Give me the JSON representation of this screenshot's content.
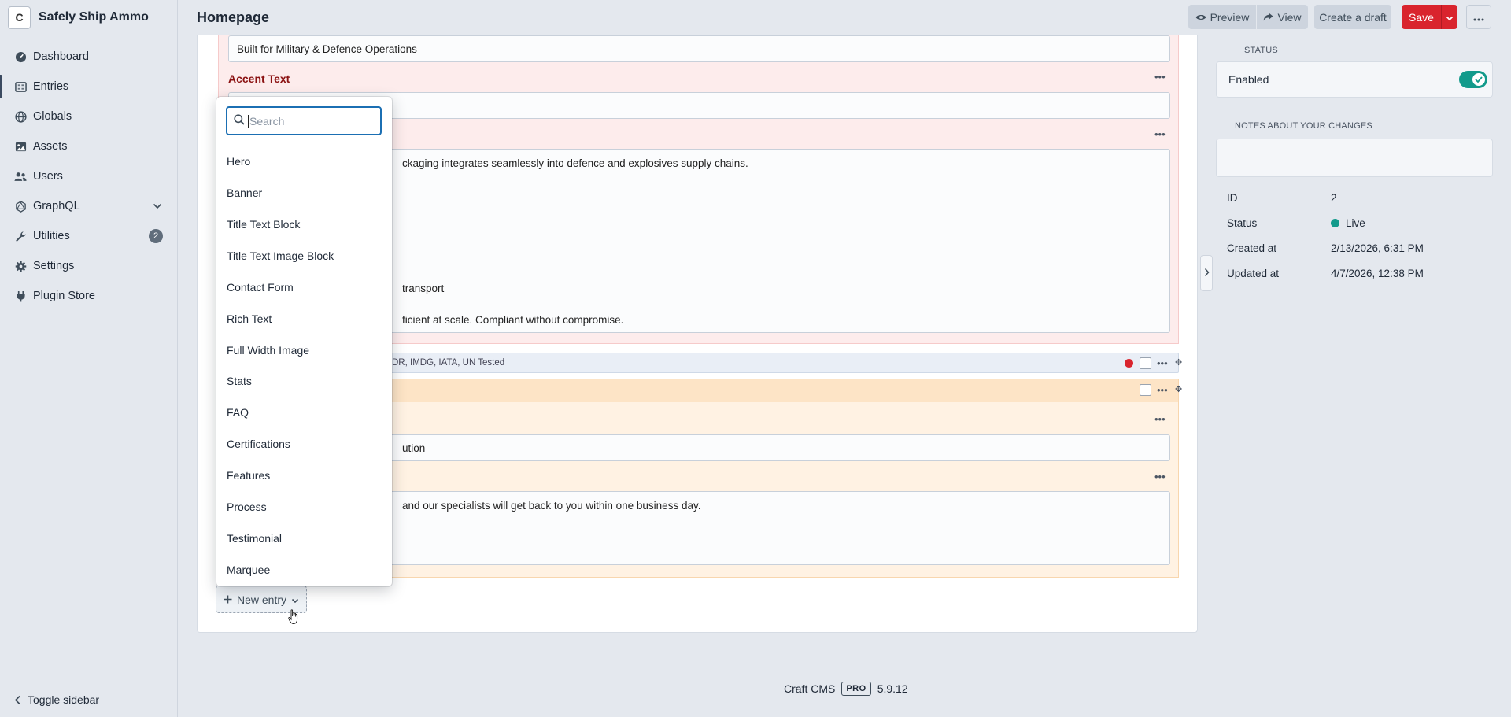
{
  "site": {
    "logo_letter": "C",
    "name": "Safely Ship Ammo"
  },
  "nav": {
    "items": [
      {
        "label": "Dashboard",
        "icon": "gauge-icon"
      },
      {
        "label": "Entries",
        "icon": "entries-icon"
      },
      {
        "label": "Globals",
        "icon": "globe-icon"
      },
      {
        "label": "Assets",
        "icon": "image-icon"
      },
      {
        "label": "Users",
        "icon": "users-icon"
      },
      {
        "label": "GraphQL",
        "icon": "graphql-icon"
      },
      {
        "label": "Utilities",
        "icon": "wrench-icon",
        "badge": "2"
      },
      {
        "label": "Settings",
        "icon": "gear-icon"
      },
      {
        "label": "Plugin Store",
        "icon": "plug-icon"
      }
    ],
    "toggle_sidebar": "Toggle sidebar"
  },
  "header": {
    "title": "Homepage",
    "preview": "Preview",
    "view": "View",
    "create_draft": "Create a draft",
    "save": "Save"
  },
  "editor": {
    "heading_value": "Built for Military & Defence Operations",
    "accent_text_label": "Accent Text",
    "body_lines": [
      "ckaging integrates seamlessly into defence and explosives supply chains.",
      "transport",
      "ficient at scale. Compliant without compromise."
    ],
    "collapsed_block_text": "DR, IMDG, IATA, UN Tested",
    "orange_input_value": "ution",
    "orange_textarea_text": "and our specialists will get back to you within one business day.",
    "new_entry_label": "New entry"
  },
  "dropdown": {
    "search_placeholder": "Search",
    "items": [
      "Hero",
      "Banner",
      "Title Text Block",
      "Title Text Image Block",
      "Contact Form",
      "Rich Text",
      "Full Width Image",
      "Stats",
      "FAQ",
      "Certifications",
      "Features",
      "Process",
      "Testimonial",
      "Marquee"
    ]
  },
  "details": {
    "status_title": "STATUS",
    "enabled_label": "Enabled",
    "enabled": true,
    "notes_title": "NOTES ABOUT YOUR CHANGES",
    "meta": [
      {
        "label": "ID",
        "value": "2"
      },
      {
        "label": "Status",
        "value": "Live"
      },
      {
        "label": "Created at",
        "value": "2/13/2026, 6:31 PM"
      },
      {
        "label": "Updated at",
        "value": "4/7/2026, 12:38 PM"
      }
    ]
  },
  "footer": {
    "product": "Craft CMS",
    "edition": "PRO",
    "version": "5.9.12"
  },
  "colors": {
    "save": "#d9242d",
    "toggle_on": "#129a8b",
    "search_focus": "#1b6fb3",
    "block_red_bg": "#fdecec",
    "block_orange_bg": "#fff2e3"
  }
}
